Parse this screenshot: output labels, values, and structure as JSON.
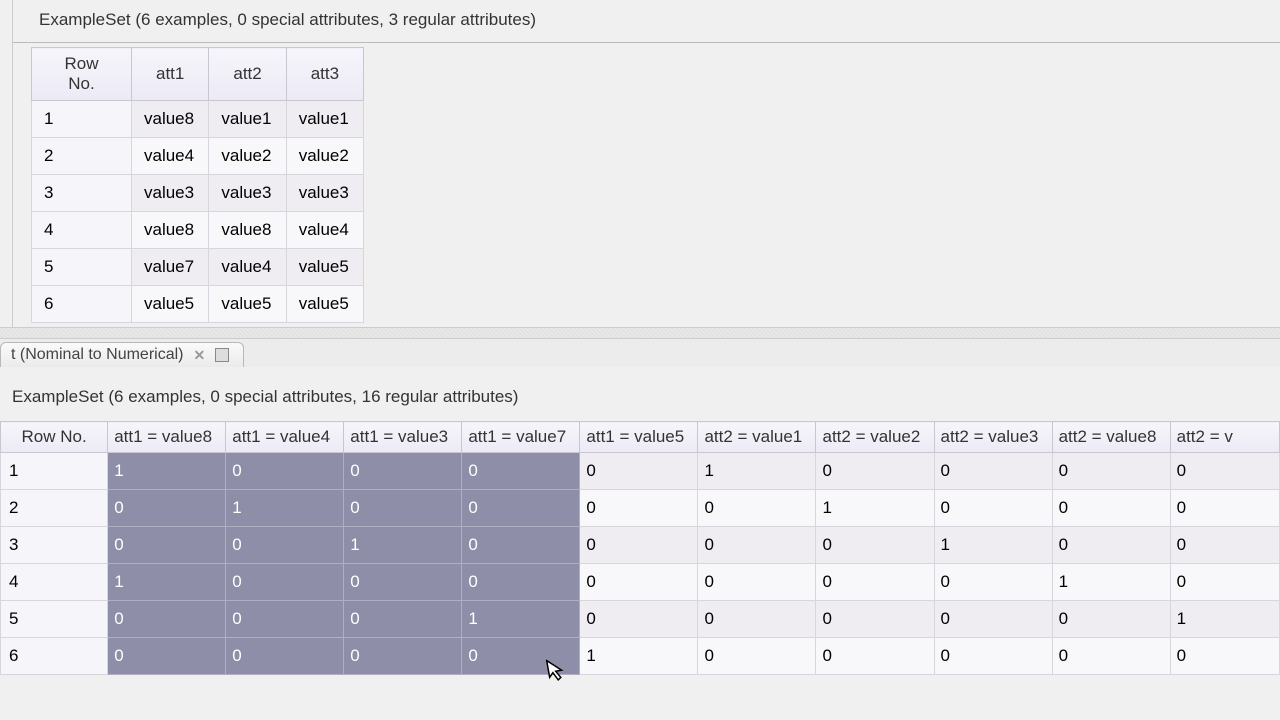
{
  "top": {
    "summary": "ExampleSet (6 examples, 0 special attributes, 3 regular attributes)",
    "headers": [
      "Row No.",
      "att1",
      "att2",
      "att3"
    ],
    "rows": [
      {
        "no": "1",
        "c": [
          "value8",
          "value1",
          "value1"
        ]
      },
      {
        "no": "2",
        "c": [
          "value4",
          "value2",
          "value2"
        ]
      },
      {
        "no": "3",
        "c": [
          "value3",
          "value3",
          "value3"
        ]
      },
      {
        "no": "4",
        "c": [
          "value8",
          "value8",
          "value4"
        ]
      },
      {
        "no": "5",
        "c": [
          "value7",
          "value4",
          "value5"
        ]
      },
      {
        "no": "6",
        "c": [
          "value5",
          "value5",
          "value5"
        ]
      }
    ]
  },
  "tab": {
    "label": "t (Nominal to Numerical)"
  },
  "bottom": {
    "summary": "ExampleSet (6 examples, 0 special attributes, 16 regular attributes)",
    "headers": [
      "Row No.",
      "att1 = value8",
      "att1 = value4",
      "att1 = value3",
      "att1 = value7",
      "att1 = value5",
      "att2 = value1",
      "att2 = value2",
      "att2 = value3",
      "att2 = value8",
      "att2 = v"
    ],
    "sel_cols": 4,
    "rows": [
      {
        "no": "1",
        "c": [
          "1",
          "0",
          "0",
          "0",
          "0",
          "1",
          "0",
          "0",
          "0",
          "0"
        ]
      },
      {
        "no": "2",
        "c": [
          "0",
          "1",
          "0",
          "0",
          "0",
          "0",
          "1",
          "0",
          "0",
          "0"
        ]
      },
      {
        "no": "3",
        "c": [
          "0",
          "0",
          "1",
          "0",
          "0",
          "0",
          "0",
          "1",
          "0",
          "0"
        ]
      },
      {
        "no": "4",
        "c": [
          "1",
          "0",
          "0",
          "0",
          "0",
          "0",
          "0",
          "0",
          "1",
          "0"
        ]
      },
      {
        "no": "5",
        "c": [
          "0",
          "0",
          "0",
          "1",
          "0",
          "0",
          "0",
          "0",
          "0",
          "1"
        ]
      },
      {
        "no": "6",
        "c": [
          "0",
          "0",
          "0",
          "0",
          "1",
          "0",
          "0",
          "0",
          "0",
          "0"
        ]
      }
    ]
  }
}
